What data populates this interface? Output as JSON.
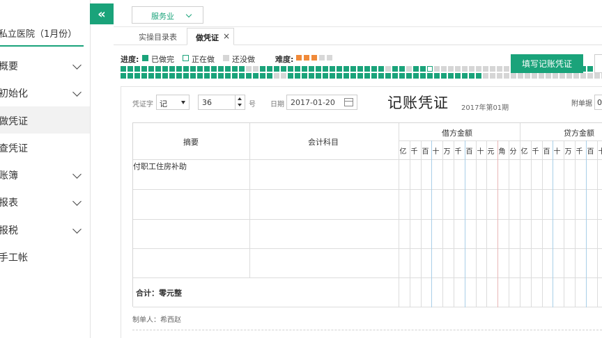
{
  "sidebar": {
    "title": "私立医院（1月份）",
    "items": [
      {
        "label": "概要",
        "expandable": true,
        "active": false
      },
      {
        "label": "初始化",
        "expandable": true,
        "active": false
      },
      {
        "label": "做凭证",
        "expandable": false,
        "active": true
      },
      {
        "label": "查凭证",
        "expandable": false,
        "active": false
      },
      {
        "label": "账簿",
        "expandable": true,
        "active": false
      },
      {
        "label": "报表",
        "expandable": true,
        "active": false
      },
      {
        "label": "报税",
        "expandable": true,
        "active": false
      },
      {
        "label": "手工帐",
        "expandable": false,
        "active": false
      }
    ]
  },
  "topbar": {
    "collapse_icon": "«",
    "industry": "服务业"
  },
  "tabs": [
    {
      "label": "实操目录表",
      "active": false
    },
    {
      "label": "做凭证",
      "active": true,
      "close": "×"
    }
  ],
  "progress": {
    "label": "进度:",
    "legend": [
      {
        "label": "已做完",
        "color": "#1aa37a",
        "style": "filled"
      },
      {
        "label": "正在做",
        "color": "#1aa37a",
        "style": "outline"
      },
      {
        "label": "还没做",
        "color": "#d6d6d6",
        "style": "filled"
      }
    ],
    "difficulty_label": "难度:",
    "difficulty": {
      "filled": 3,
      "total": 5
    },
    "cells": [
      "done",
      "done",
      "done",
      "done",
      "done",
      "done",
      "done",
      "done",
      "done",
      "done",
      "done",
      "done",
      "done",
      "done",
      "done",
      "done",
      "done",
      "done",
      "todo",
      "todo",
      "done",
      "done",
      "done",
      "done",
      "done",
      "done",
      "done",
      "done",
      "done",
      "done",
      "done",
      "done",
      "done",
      "done",
      "done",
      "done",
      "done",
      "done",
      "todo",
      "done",
      "done",
      "todo",
      "done",
      "done",
      "current",
      "todo",
      "todo",
      "todo",
      "todo",
      "todo",
      "todo",
      "todo",
      "todo",
      "todo",
      "todo",
      "todo",
      "todo",
      "todo",
      "todo",
      "todo",
      "todo",
      "todo",
      "done",
      "done",
      "done",
      "done",
      "done",
      "done",
      "done",
      "done",
      "done",
      "done",
      "done",
      "done",
      "done",
      "done",
      "done",
      "done",
      "done",
      "done",
      "done",
      "done",
      "done",
      "done",
      "done",
      "done",
      "done",
      "done",
      "done",
      "done",
      "done",
      "done",
      "done",
      "done",
      "todo",
      "todo",
      "done",
      "done",
      "done",
      "done",
      "done",
      "done",
      "done",
      "done",
      "done",
      "done",
      "done",
      "done",
      "done",
      "done",
      "done",
      "done",
      "done",
      "done",
      "done",
      "done",
      "done",
      "done",
      "done",
      "done",
      "done",
      "done",
      "done",
      "done",
      "todo",
      "todo",
      "todo",
      "todo",
      "todo",
      "todo",
      "todo",
      "todo",
      "todo",
      "todo",
      "todo",
      "todo",
      "todo",
      "todo",
      "todo",
      "todo",
      "todo",
      "todo"
    ]
  },
  "fill_button": "填写记账凭证",
  "voucher": {
    "word_label": "凭证字",
    "word_value": "记",
    "number_value": "36",
    "number_suffix": "号",
    "date_label": "日期",
    "date_value": "2017-01-20",
    "title": "记账凭证",
    "period": "2017年第01期",
    "attach_label": "附单据",
    "attach_value": "0"
  },
  "table": {
    "col_summary": "摘要",
    "col_account": "会计科目",
    "col_debit": "借方金额",
    "col_credit": "贷方金额",
    "debit_digits": [
      "亿",
      "千",
      "百",
      "十",
      "万",
      "千",
      "百",
      "十",
      "元",
      "角",
      "分"
    ],
    "credit_digits": [
      "亿",
      "千",
      "百",
      "十",
      "万",
      "千",
      "百",
      "十"
    ],
    "rows": [
      {
        "summary": "付职工住房补助",
        "account": ""
      },
      {
        "summary": "",
        "account": ""
      },
      {
        "summary": "",
        "account": ""
      },
      {
        "summary": "",
        "account": ""
      }
    ],
    "total": "合计：零元整"
  },
  "maker": "制单人：希西赵"
}
